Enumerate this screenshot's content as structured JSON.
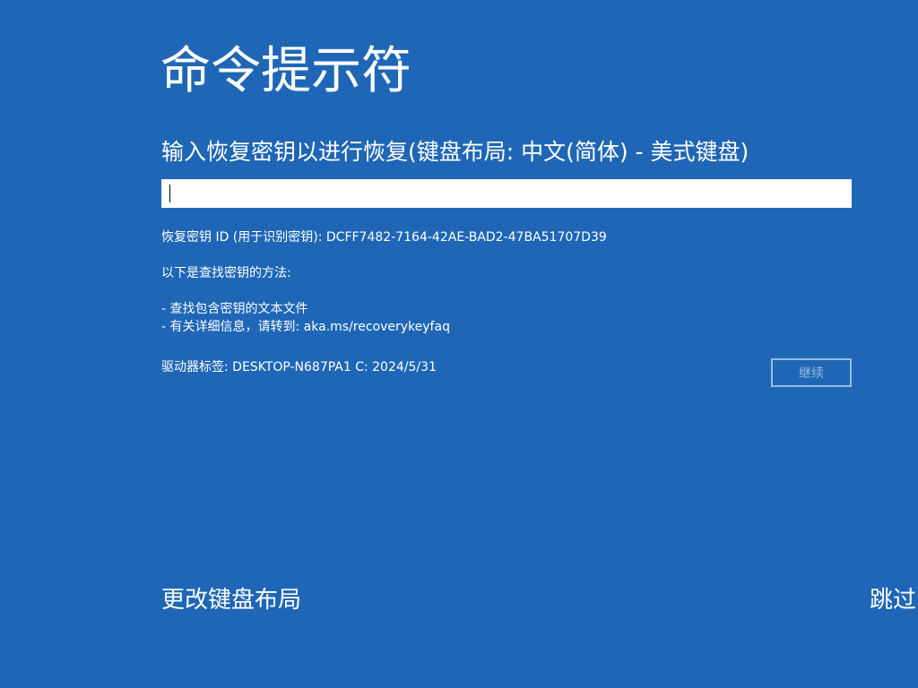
{
  "title": "命令提示符",
  "prompt": "输入恢复密钥以进行恢复(键盘布局: 中文(简体) - 美式键盘)",
  "recovery_key_input": {
    "value": "",
    "placeholder": ""
  },
  "info": {
    "key_id_line": "恢复密钥 ID (用于识别密钥): DCFF7482-7164-42AE-BAD2-47BA51707D39",
    "how_to_find": "以下是查找密钥的方法:",
    "tips": [
      "- 查找包含密钥的文本文件",
      "- 有关详细信息，请转到: aka.ms/recoverykeyfaq"
    ],
    "drive_label": "驱动器标签: DESKTOP-N687PA1 C: 2024/5/31"
  },
  "buttons": {
    "continue_label": "继续",
    "change_keyboard_layout_label": "更改键盘布局",
    "skip_label": "跳过"
  },
  "colors": {
    "background": "#1f67b6",
    "text": "#ffffff",
    "disabled_button": "#9cb9db",
    "input_background": "#ffffff"
  }
}
